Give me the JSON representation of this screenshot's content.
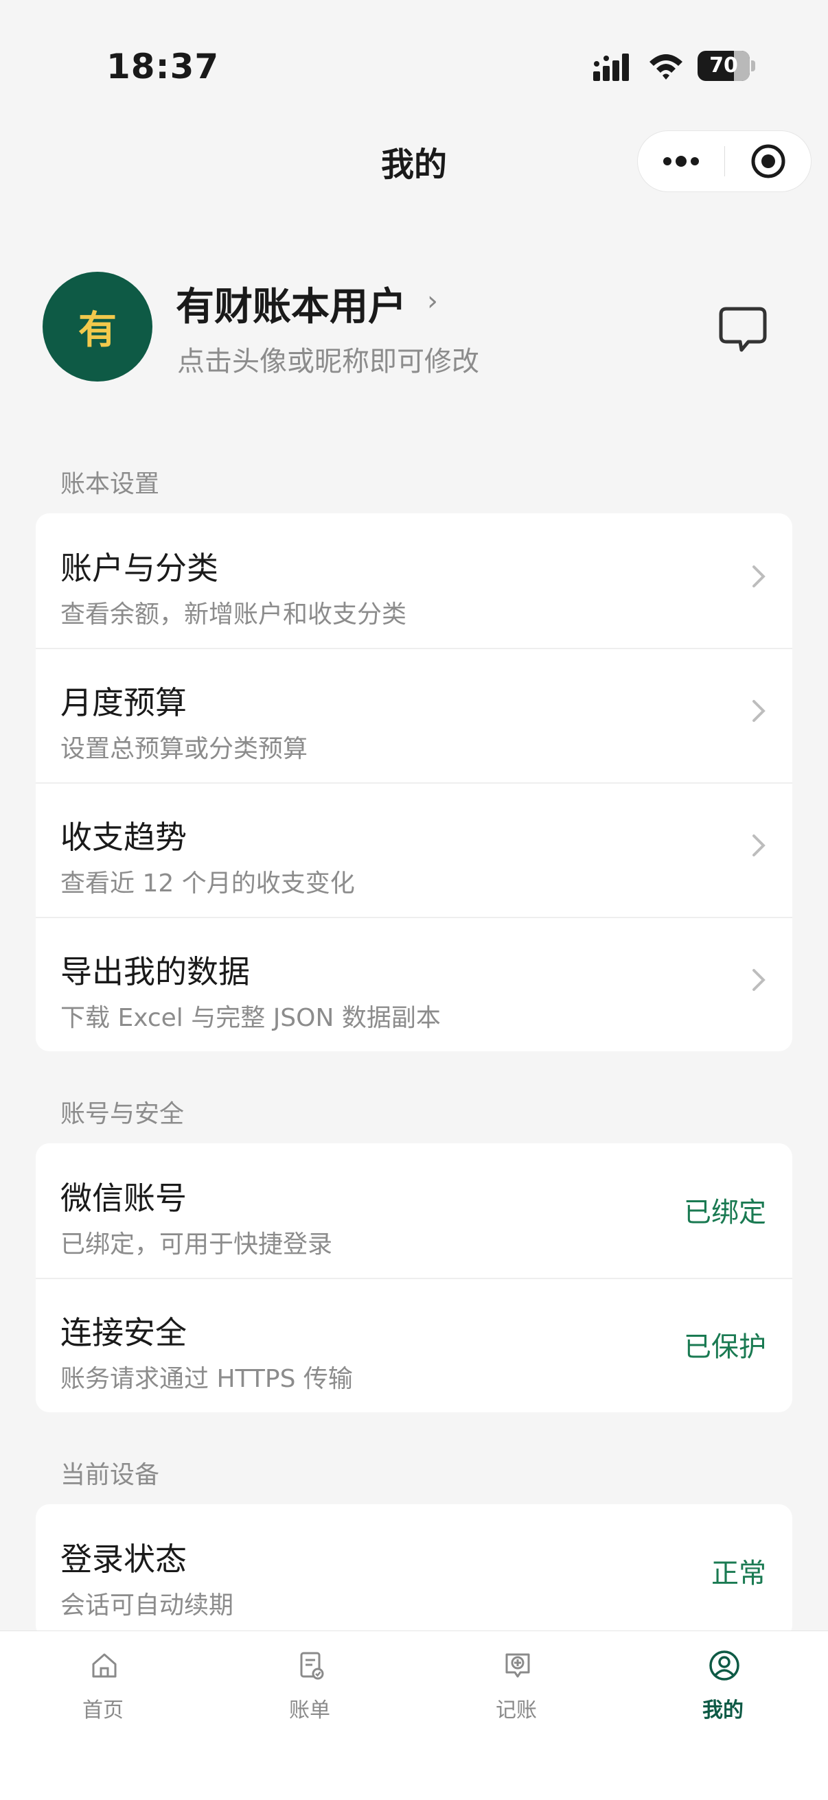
{
  "status_bar": {
    "time": "18:37",
    "battery_level": "70",
    "battery_fraction": 0.7
  },
  "nav": {
    "title": "我的"
  },
  "profile": {
    "avatar_char": "有",
    "name": "有财账本用户",
    "hint": "点击头像或昵称即可修改"
  },
  "sections": {
    "ledger_settings": {
      "label": "账本设置",
      "items": [
        {
          "title": "账户与分类",
          "subtitle": "查看余额，新增账户和收支分类"
        },
        {
          "title": "月度预算",
          "subtitle": "设置总预算或分类预算"
        },
        {
          "title": "收支趋势",
          "subtitle": "查看近 12 个月的收支变化"
        },
        {
          "title": "导出我的数据",
          "subtitle": "下载 Excel 与完整 JSON 数据副本"
        }
      ]
    },
    "account_security": {
      "label": "账号与安全",
      "items": [
        {
          "title": "微信账号",
          "subtitle": "已绑定，可用于快捷登录",
          "status": "已绑定"
        },
        {
          "title": "连接安全",
          "subtitle": "账务请求通过 HTTPS 传输",
          "status": "已保护"
        }
      ]
    },
    "current_device": {
      "label": "当前设备",
      "items": [
        {
          "title": "登录状态",
          "subtitle": "会话可自动续期",
          "status": "正常"
        }
      ]
    }
  },
  "tabbar": {
    "items": [
      {
        "label": "首页",
        "icon": "home-icon"
      },
      {
        "label": "账单",
        "icon": "bill-icon"
      },
      {
        "label": "记账",
        "icon": "add-record-icon"
      },
      {
        "label": "我的",
        "icon": "profile-icon",
        "active": true
      }
    ]
  },
  "colors": {
    "accent": "#0e5a45",
    "status_green": "#1a7a52",
    "avatar_text": "#f2c94c"
  }
}
